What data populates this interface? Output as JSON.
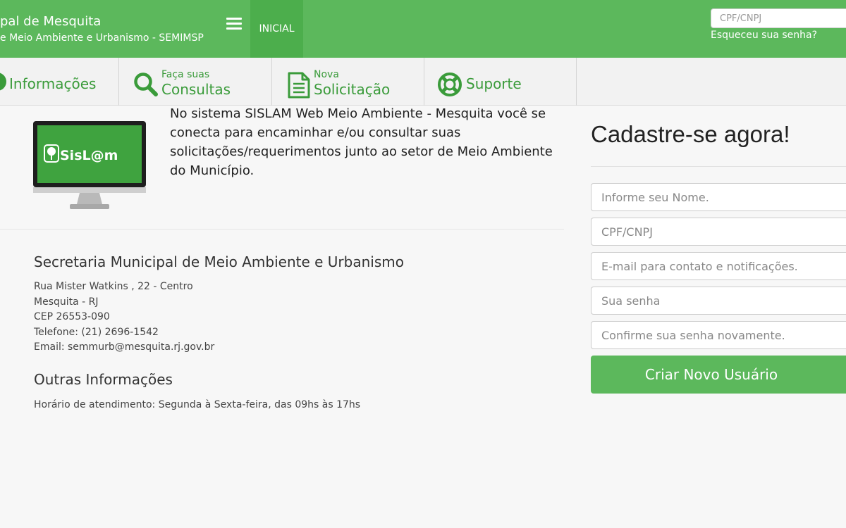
{
  "header": {
    "title": "pal de Mesquita",
    "subtitle": "e Meio Ambiente e Urbanismo - SEMIMSP",
    "nav_inicial": "INICIAL",
    "login_placeholder": "CPF/CNPJ",
    "forgot_password": "Esqueceu sua senha?",
    "brand_color": "#5cb85c"
  },
  "menu": {
    "informacoes": {
      "label": "Informações",
      "icon": "info-icon"
    },
    "consultas": {
      "small": "Faça suas",
      "big": "Consultas",
      "icon": "search-icon"
    },
    "solicitacao": {
      "small": "Nova",
      "big": "Solicitação",
      "icon": "document-icon"
    },
    "suporte": {
      "label": "Suporte",
      "icon": "lifebuoy-icon"
    }
  },
  "intro": {
    "logo_text": "SisL@m",
    "text": "No sistema SISLAM Web Meio Ambiente - Mesquita você se conecta para encaminhar e/ou consultar suas solicitações/requerimentos junto ao setor de Meio Ambiente do Município."
  },
  "info": {
    "title": "Secretaria Municipal de Meio Ambiente e Urbanismo",
    "address_line1": "Rua Mister Watkins , 22 - Centro",
    "address_line2": "Mesquita - RJ",
    "cep": "CEP 26553-090",
    "phone": "Telefone: (21) 2696-1542",
    "email": "Email: semmurb@mesquita.rj.gov.br",
    "other_title": "Outras Informações",
    "hours": "Horário de atendimento: Segunda à Sexta-feira, das 09hs às 17hs"
  },
  "register": {
    "title": "Cadastre-se agora!",
    "name_placeholder": "Informe seu Nome.",
    "cpf_placeholder": "CPF/CNPJ",
    "email_placeholder": "E-mail para contato e notificações.",
    "password_placeholder": "Sua senha",
    "confirm_placeholder": "Confirme sua senha novamente.",
    "button": "Criar Novo Usuário"
  }
}
